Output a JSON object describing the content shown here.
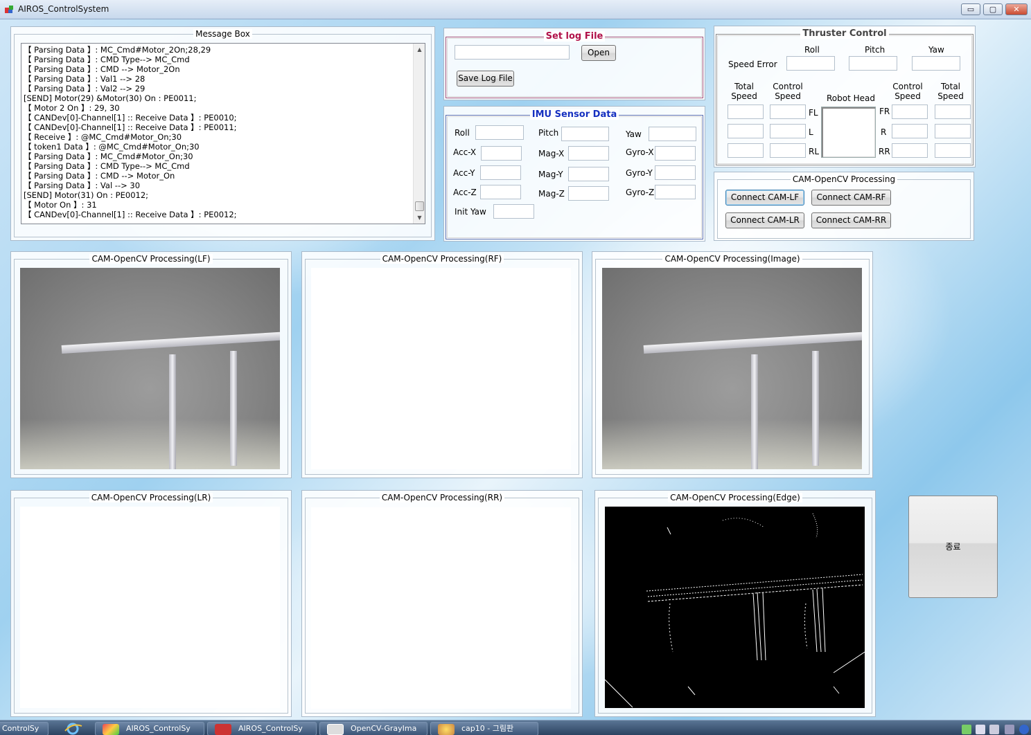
{
  "window": {
    "title": "AIROS_ControlSystem",
    "controls": {
      "minimize": "▭",
      "maximize": "▢",
      "close": "✕"
    }
  },
  "message_box": {
    "title": "Message Box",
    "lines": [
      "【 Parsing Data 】: MC_Cmd#Motor_2On;28,29",
      "【 Parsing Data 】: CMD Type--> MC_Cmd",
      "【 Parsing Data 】: CMD --> Motor_2On",
      "【 Parsing Data 】: Val1 --> 28",
      "【 Parsing Data 】: Val2 --> 29",
      "[SEND] Motor(29) &Motor(30) On : PE0011;",
      "【 Motor 2 On 】: 29, 30",
      "【 CANDev[0]-Channel[1] :: Receive Data 】: PE0010;",
      "【 CANDev[0]-Channel[1] :: Receive Data 】: PE0011;",
      "【 Receive 】: @MC_Cmd#Motor_On;30",
      "【 token1 Data 】: @MC_Cmd#Motor_On;30",
      "【 Parsing Data 】: MC_Cmd#Motor_On;30",
      "【 Parsing Data 】: CMD Type--> MC_Cmd",
      "【 Parsing Data 】: CMD --> Motor_On",
      "【 Parsing Data 】: Val --> 30",
      "[SEND] Motor(31) On : PE0012;",
      "【 Motor On 】: 31",
      "【 CANDev[0]-Channel[1] :: Receive Data 】: PE0012;"
    ]
  },
  "log": {
    "title": "Set log File",
    "path_value": "",
    "open_label": "Open",
    "save_label": "Save Log File"
  },
  "imu": {
    "title": "IMU Sensor Data",
    "roll": "Roll",
    "pitch": "Pitch",
    "yaw": "Yaw",
    "acc_x": "Acc-X",
    "acc_y": "Acc-Y",
    "acc_z": "Acc-Z",
    "mag_x": "Mag-X",
    "mag_y": "Mag-Y",
    "mag_z": "Mag-Z",
    "gyro_x": "Gyro-X",
    "gyro_y": "Gyro-Y",
    "gyro_z": "Gyro-Z",
    "init_yaw": "Init Yaw"
  },
  "thruster": {
    "title": "Thruster Control",
    "roll": "Roll",
    "pitch": "Pitch",
    "yaw": "Yaw",
    "speed_error": "Speed Error",
    "total_speed": "Total\nSpeed",
    "control_speed": "Control\nSpeed",
    "robot_head": "Robot Head",
    "fl": "FL",
    "l": "L",
    "rl": "RL",
    "fr": "FR",
    "r": "R",
    "rr": "RR"
  },
  "cam_processing": {
    "title": "CAM-OpenCV Processing",
    "connect_lf": "Connect CAM-LF",
    "connect_rf": "Connect CAM-RF",
    "connect_lr": "Connect CAM-LR",
    "connect_rr": "Connect CAM-RR"
  },
  "views": {
    "lf": "CAM-OpenCV Processing(LF)",
    "rf": "CAM-OpenCV Processing(RF)",
    "image": "CAM-OpenCV Processing(Image)",
    "lr": "CAM-OpenCV Processing(LR)",
    "rr": "CAM-OpenCV Processing(RR)",
    "edge": "CAM-OpenCV Processing(Edge)"
  },
  "exit_label": "종료",
  "taskbar": {
    "items": [
      "ControlSy",
      "AIROS_ControlSy",
      "AIROS_ControlSy",
      "OpenCV-GrayIma",
      "cap10 - 그림판"
    ]
  }
}
